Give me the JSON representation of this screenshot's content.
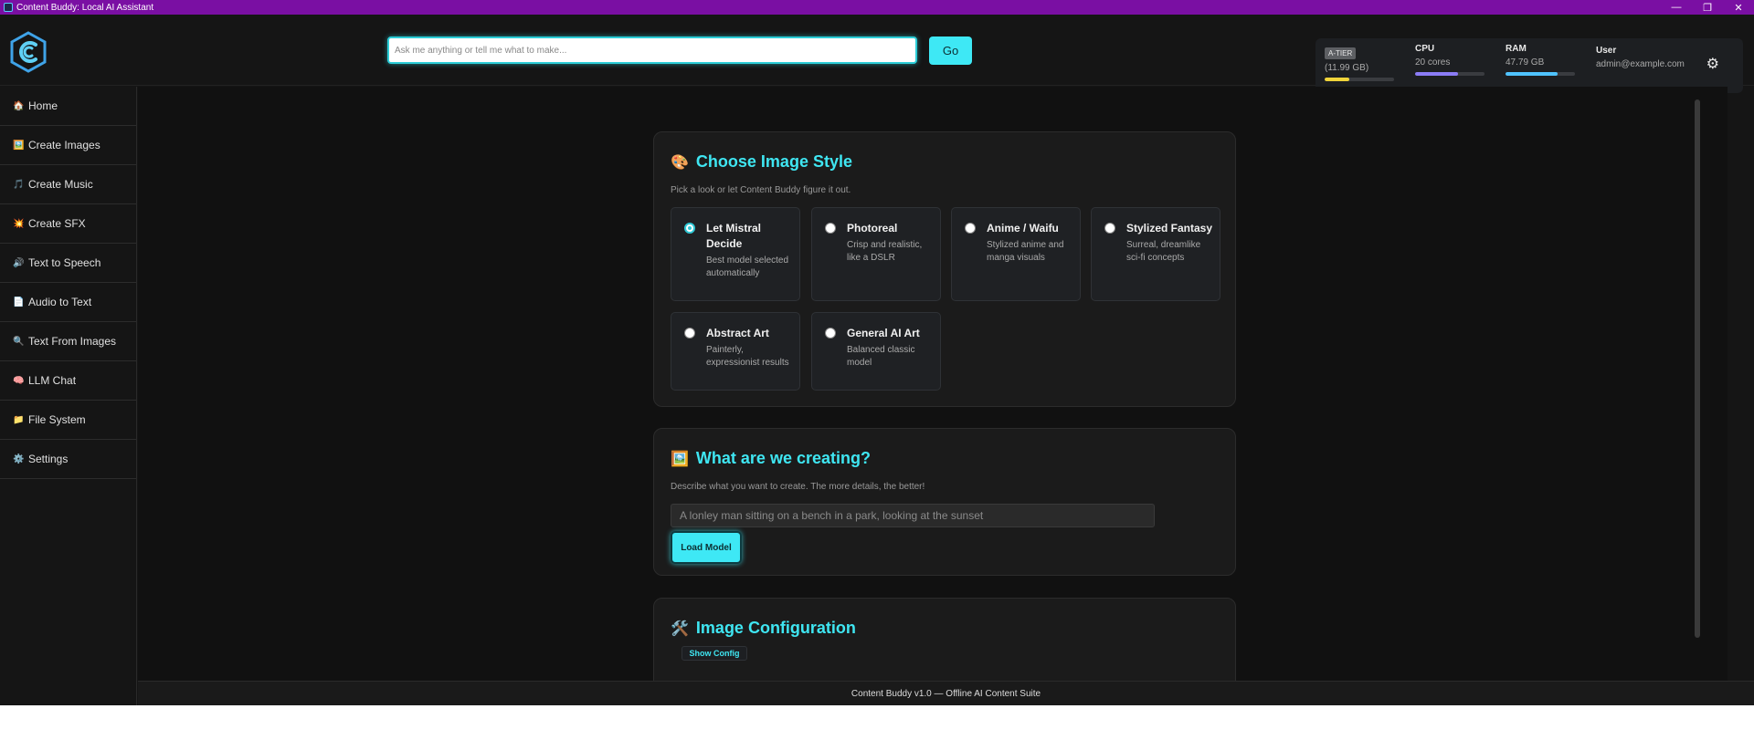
{
  "window": {
    "title": "Content Buddy: Local AI Assistant",
    "controls": [
      "—",
      "❐",
      "✕"
    ]
  },
  "header": {
    "search_placeholder": "Ask me anything or tell me what to make...",
    "go_label": "Go",
    "stats": {
      "tier_badge": "A-TIER",
      "tier_value": "(11.99 GB)",
      "tier_fill": 0.35,
      "cpu_label": "CPU",
      "cpu_value": "20 cores",
      "cpu_fill": 0.62,
      "ram_label": "RAM",
      "ram_value": "47.79 GB",
      "ram_fill": 0.75,
      "user_label": "User",
      "user_value": "admin@example.com"
    },
    "colors": {
      "tier": "#f0d43a",
      "cpu": "#8b7cf6",
      "ram": "#4fc3ff",
      "accent": "#3ee8f5"
    }
  },
  "sidebar": {
    "items": [
      {
        "icon": "🏠",
        "label": "Home"
      },
      {
        "icon": "🖼️",
        "label": "Create Images"
      },
      {
        "icon": "🎵",
        "label": "Create Music"
      },
      {
        "icon": "💥",
        "label": "Create SFX"
      },
      {
        "icon": "🔊",
        "label": "Text to Speech"
      },
      {
        "icon": "📄",
        "label": "Audio to Text"
      },
      {
        "icon": "🔍",
        "label": "Text From Images"
      },
      {
        "icon": "🧠",
        "label": "LLM Chat"
      },
      {
        "icon": "📁",
        "label": "File System"
      },
      {
        "icon": "⚙️",
        "label": "Settings"
      }
    ]
  },
  "style_card": {
    "icon": "🎨",
    "title": "Choose Image Style",
    "subtitle": "Pick a look or let Content Buddy figure it out.",
    "options": [
      {
        "title": "Let Mistral Decide",
        "desc": "Best model selected automatically",
        "selected": true
      },
      {
        "title": "Photoreal",
        "desc": "Crisp and realistic, like a DSLR",
        "selected": false
      },
      {
        "title": "Anime / Waifu",
        "desc": "Stylized anime and manga visuals",
        "selected": false
      },
      {
        "title": "Stylized Fantasy",
        "desc": "Surreal, dreamlike sci-fi concepts",
        "selected": false
      },
      {
        "title": "Abstract Art",
        "desc": "Painterly, expressionist results",
        "selected": false
      },
      {
        "title": "General AI Art",
        "desc": "Balanced classic model",
        "selected": false
      }
    ]
  },
  "create_card": {
    "icon": "🖼️",
    "title": "What are we creating?",
    "subtitle": "Describe what you want to create. The more details, the better!",
    "prompt_placeholder": "A lonley man sitting on a bench in a park, looking at the sunset",
    "load_label": "Load Model"
  },
  "config_card": {
    "icon": "🛠️",
    "title": "Image Configuration",
    "show_config_label": "Show Config"
  },
  "footer": {
    "text": "Content Buddy v1.0 — Offline AI Content Suite"
  }
}
